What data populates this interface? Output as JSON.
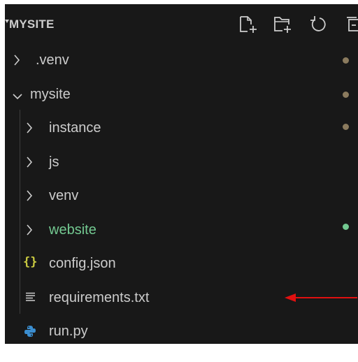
{
  "explorer": {
    "title": "MYSITE",
    "actions": {
      "new_file": "new-file-icon",
      "new_folder": "new-folder-icon",
      "refresh": "refresh-icon",
      "collapse": "collapse-all-icon"
    },
    "items": [
      {
        "label": ".venv",
        "type": "folder",
        "expanded": false,
        "depth": 0,
        "status_dot": "#8b7b5e",
        "label_color": "#cccccc"
      },
      {
        "label": "mysite",
        "type": "folder",
        "expanded": true,
        "depth": 0,
        "status_dot": "#8b7b5e",
        "label_color": "#cccccc"
      },
      {
        "label": "instance",
        "type": "folder",
        "expanded": false,
        "depth": 1,
        "status_dot": "#8b7b5e",
        "label_color": "#cccccc"
      },
      {
        "label": "js",
        "type": "folder",
        "expanded": false,
        "depth": 1,
        "status_dot": null,
        "label_color": "#cccccc"
      },
      {
        "label": "venv",
        "type": "folder",
        "expanded": false,
        "depth": 1,
        "status_dot": null,
        "label_color": "#cccccc"
      },
      {
        "label": "website",
        "type": "folder",
        "expanded": false,
        "depth": 1,
        "status_dot": "#73c991",
        "label_color": "#73c991"
      },
      {
        "label": "config.json",
        "type": "json-file",
        "depth": 1,
        "icon": "json-braces-icon",
        "label_color": "#cccccc"
      },
      {
        "label": "requirements.txt",
        "type": "text-file",
        "depth": 1,
        "icon": "text-lines-icon",
        "label_color": "#cccccc"
      },
      {
        "label": "run.py",
        "type": "python-file",
        "depth": 1,
        "icon": "python-icon",
        "label_color": "#cccccc"
      }
    ]
  },
  "colors": {
    "panel_bg": "#181818",
    "text": "#cccccc",
    "modified_dot": "#8b7b5e",
    "untracked_green": "#73c991",
    "json_icon": "#cbcb41",
    "python_icon": "#3b8ed0",
    "annotation_arrow": "#e01010"
  },
  "annotation": {
    "type": "arrow",
    "points_to": "requirements.txt"
  }
}
